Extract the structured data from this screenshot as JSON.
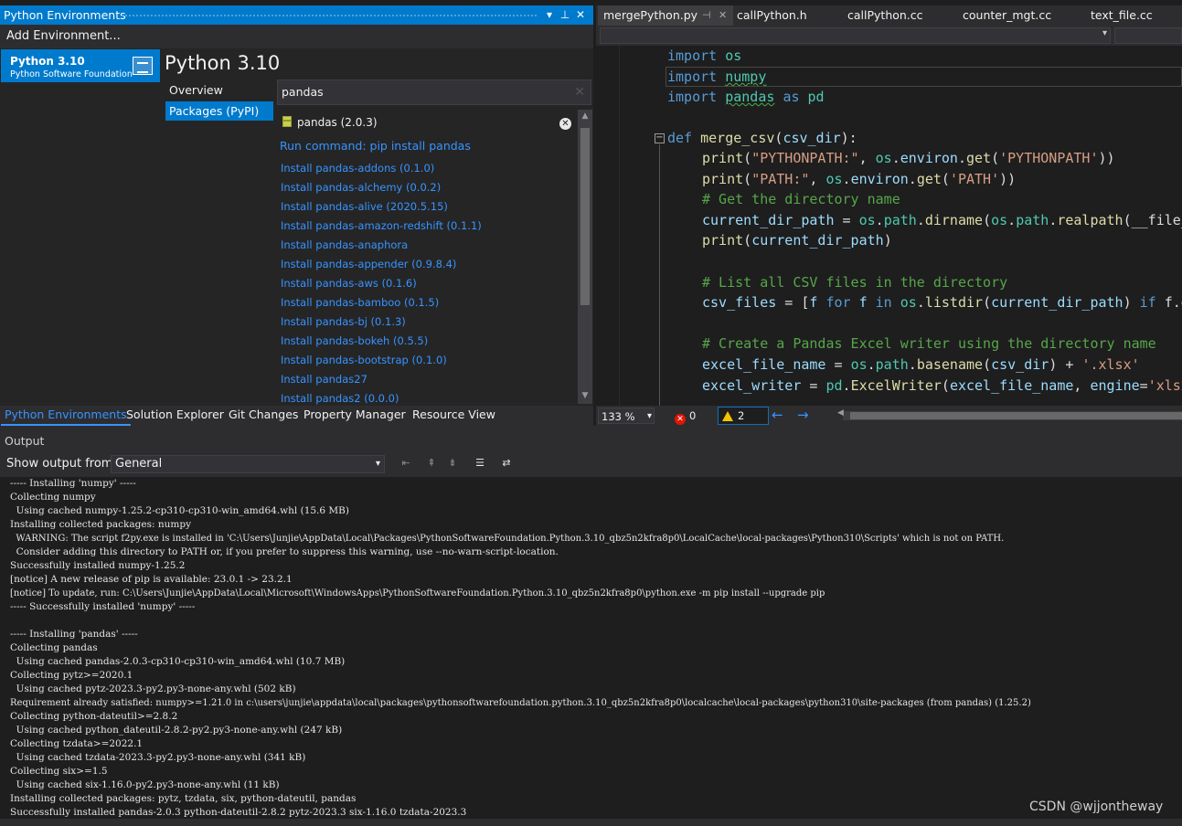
{
  "pe_panel": {
    "title": "Python Environments",
    "add_env": "Add Environment...",
    "env": {
      "name": "Python 3.10",
      "vendor": "Python Software Foundation"
    },
    "header": "Python 3.10",
    "tabs": {
      "overview": "Overview",
      "packages": "Packages (PyPI)"
    },
    "search_value": "pandas",
    "installed": "pandas (2.0.3)",
    "run_command": "Run command: pip install pandas",
    "links": [
      "Install pandas-addons (0.1.0)",
      "Install pandas-alchemy (0.0.2)",
      "Install pandas-alive (2020.5.15)",
      "Install pandas-amazon-redshift (0.1.1)",
      "Install pandas-anaphora",
      "Install pandas-appender (0.9.8.4)",
      "Install pandas-aws (0.1.6)",
      "Install pandas-bamboo (0.1.5)",
      "Install pandas-bj (0.1.3)",
      "Install pandas-bokeh (0.5.5)",
      "Install pandas-bootstrap (0.1.0)",
      "Install pandas27",
      "Install pandas2 (0.0.0)"
    ]
  },
  "tool_tabs": [
    "Python Environments",
    "Solution Explorer",
    "Git Changes",
    "Property Manager",
    "Resource View"
  ],
  "editor": {
    "tabs": [
      "mergePython.py",
      "callPython.h",
      "callPython.cc",
      "counter_mgt.cc",
      "text_file.cc"
    ],
    "zoom": "133 %",
    "errors": "0",
    "warnings": "2"
  },
  "output": {
    "title": "Output",
    "show_from_label": "Show output from:",
    "source": "General",
    "lines": [
      "----- Installing 'numpy' -----",
      "Collecting numpy",
      "  Using cached numpy-1.25.2-cp310-cp310-win_amd64.whl (15.6 MB)",
      "Installing collected packages: numpy",
      "  WARNING: The script f2py.exe is installed in 'C:\\Users\\Junjie\\AppData\\Local\\Packages\\PythonSoftwareFoundation.Python.3.10_qbz5n2kfra8p0\\LocalCache\\local-packages\\Python310\\Scripts' which is not on PATH.",
      "  Consider adding this directory to PATH or, if you prefer to suppress this warning, use --no-warn-script-location.",
      "Successfully installed numpy-1.25.2",
      "[notice] A new release of pip is available: 23.0.1 -> 23.2.1",
      "[notice] To update, run: C:\\Users\\Junjie\\AppData\\Local\\Microsoft\\WindowsApps\\PythonSoftwareFoundation.Python.3.10_qbz5n2kfra8p0\\python.exe -m pip install --upgrade pip",
      "----- Successfully installed 'numpy' -----",
      "",
      "----- Installing 'pandas' -----",
      "Collecting pandas",
      "  Using cached pandas-2.0.3-cp310-cp310-win_amd64.whl (10.7 MB)",
      "Collecting pytz>=2020.1",
      "  Using cached pytz-2023.3-py2.py3-none-any.whl (502 kB)",
      "Requirement already satisfied: numpy>=1.21.0 in c:\\users\\junjie\\appdata\\local\\packages\\pythonsoftwarefoundation.python.3.10_qbz5n2kfra8p0\\localcache\\local-packages\\python310\\site-packages (from pandas) (1.25.2)",
      "Collecting python-dateutil>=2.8.2",
      "  Using cached python_dateutil-2.8.2-py2.py3-none-any.whl (247 kB)",
      "Collecting tzdata>=2022.1",
      "  Using cached tzdata-2023.3-py2.py3-none-any.whl (341 kB)",
      "Collecting six>=1.5",
      "  Using cached six-1.16.0-py2.py3-none-any.whl (11 kB)",
      "Installing collected packages: pytz, tzdata, six, python-dateutil, pandas",
      "Successfully installed pandas-2.0.3 python-dateutil-2.8.2 pytz-2023.3 six-1.16.0 tzdata-2023.3"
    ]
  },
  "watermark": "CSDN @wjjontheway"
}
